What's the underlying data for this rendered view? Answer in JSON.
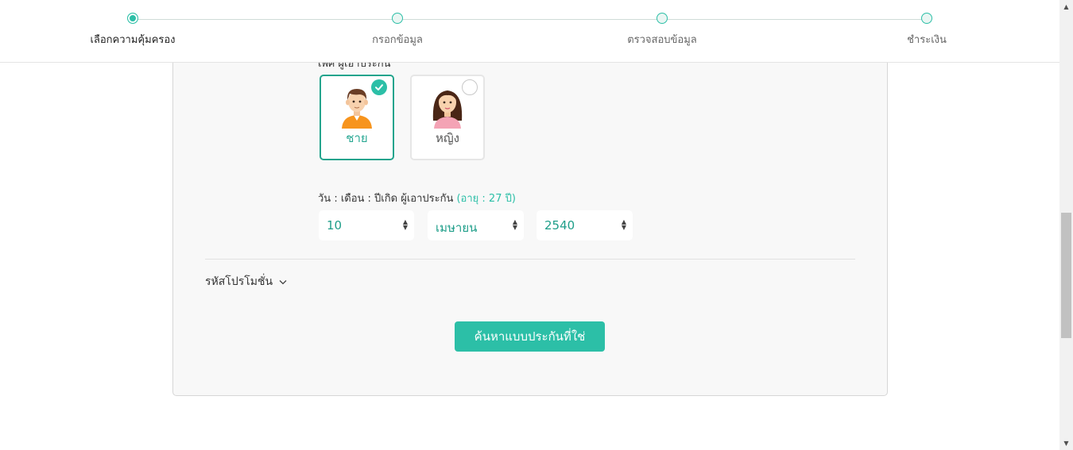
{
  "stepper": {
    "steps": [
      {
        "label": "เลือกความคุ้มครอง",
        "active": true
      },
      {
        "label": "กรอกข้อมูล",
        "active": false
      },
      {
        "label": "ตรวจสอบข้อมูล",
        "active": false
      },
      {
        "label": "ชำระเงิน",
        "active": false
      }
    ]
  },
  "form": {
    "gender_label_cut": "เพศ ผู้เอาประกัน",
    "genders": [
      {
        "label": "ชาย",
        "selected": true,
        "icon": "male-avatar-icon"
      },
      {
        "label": "หญิง",
        "selected": false,
        "icon": "female-avatar-icon"
      }
    ],
    "dob_label": "วัน : เดือน : ปีเกิด ผู้เอาประกัน",
    "age_text": "(อายุ : 27 ปี)",
    "day": "10",
    "month": "เมษายน",
    "year": "2540",
    "promo_label": "รหัสโปรโมชั่น",
    "search_button": "ค้นหาแบบประกันที่ใช่"
  },
  "colors": {
    "accent": "#2cbfa7",
    "accent_dark": "#24a48d",
    "card_bg": "#f8f8f8"
  }
}
